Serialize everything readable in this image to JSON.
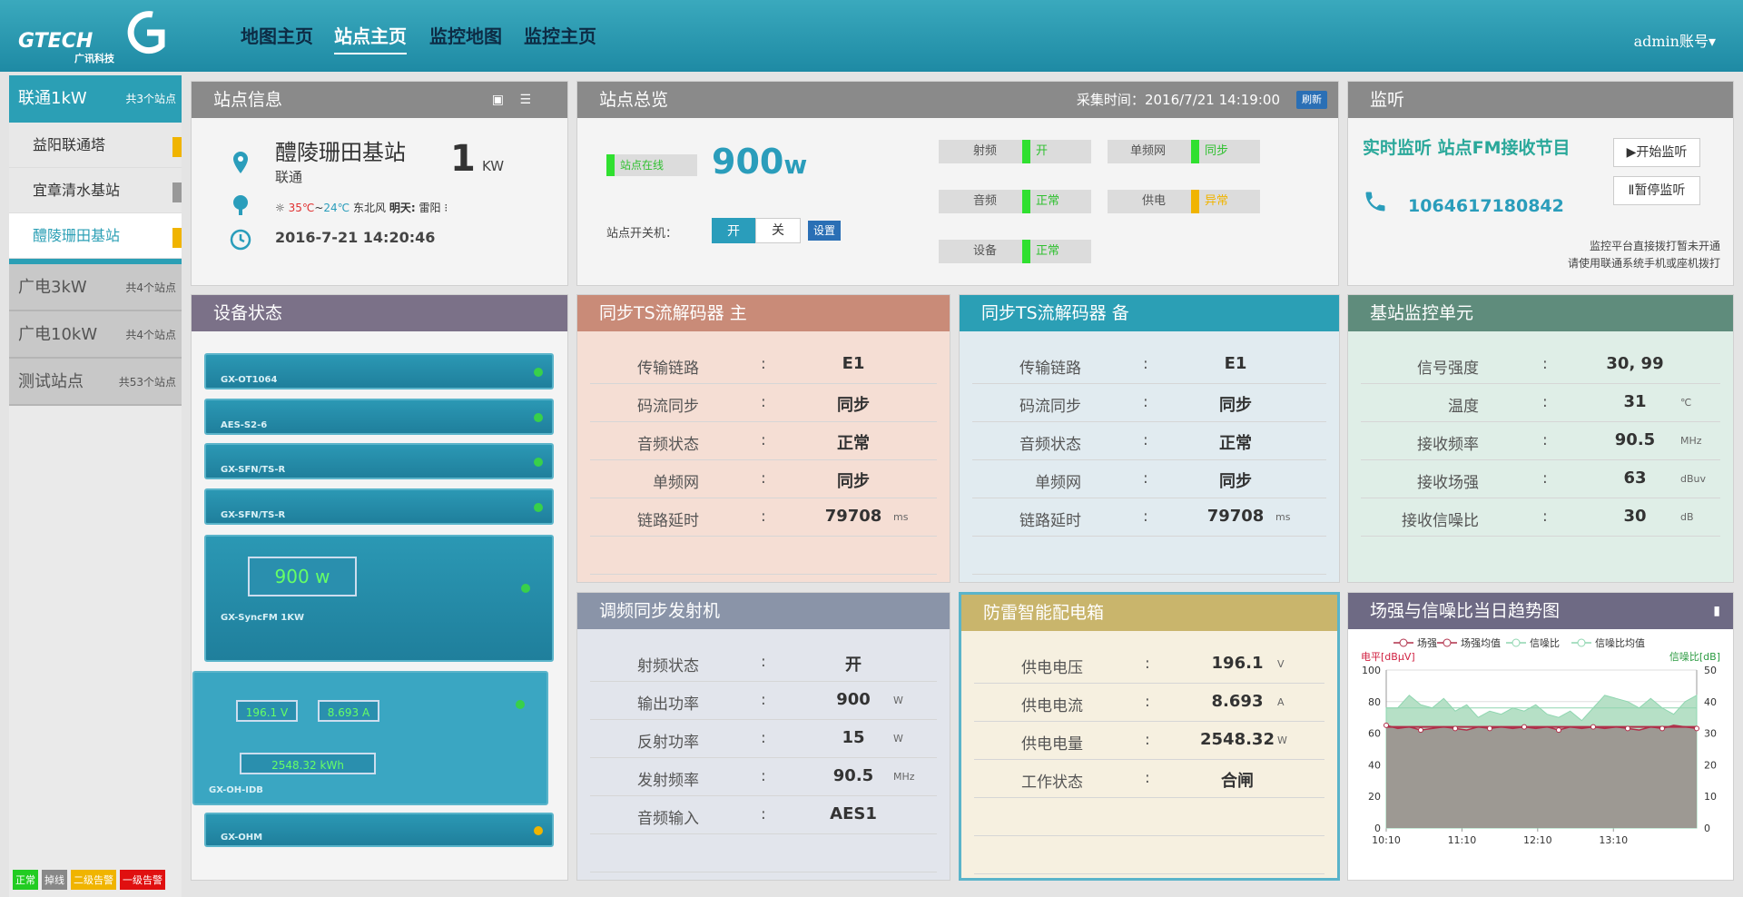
{
  "nav": {
    "logo_text": "GTECH",
    "logo_sub": "广讯科技",
    "items": [
      "地图主页",
      "站点主页",
      "监控地图",
      "监控主页"
    ],
    "account": "admin账号▾"
  },
  "sidebar": {
    "group1": {
      "label": "联通1kW",
      "count": "共3个站点"
    },
    "items": [
      {
        "label": "益阳联通塔",
        "flag": "#f0b400"
      },
      {
        "label": "宜章清水基站",
        "flag": "#999999"
      },
      {
        "label": "醴陵珊田基站",
        "flag": "#f0b400"
      }
    ],
    "groups": [
      {
        "label": "广电3kW",
        "count": "共4个站点"
      },
      {
        "label": "广电10kW",
        "count": "共4个站点"
      },
      {
        "label": "测试站点",
        "count": "共53个站点"
      }
    ],
    "legend": [
      {
        "label": "正常",
        "color": "#22cc22"
      },
      {
        "label": "掉线",
        "color": "#888888"
      },
      {
        "label": "二级告警",
        "color": "#f0b400"
      },
      {
        "label": "一级告警",
        "color": "#e01010"
      }
    ]
  },
  "site_info": {
    "title": "站点信息",
    "name": "醴陵珊田基站",
    "power_num": "1",
    "power_unit": "KW",
    "operator": "联通",
    "weather": {
      "temp_hi": "35℃",
      "sep": "~",
      "temp_lo": "24℃",
      "wind": "东北风",
      "tmr_label": "明天:",
      "tmr": "雷阳"
    },
    "time": "2016-7-21 14:20:46"
  },
  "overview": {
    "title": "站点总览",
    "collect_label": "采集时间：",
    "collect_time": "2016/7/21 14:19:00",
    "refresh": "刷新",
    "online": "站点在线",
    "power": "900",
    "power_unit": "w",
    "switch_label": "站点开关机：",
    "on": "开",
    "off": "关",
    "set": "设置",
    "statuses": [
      {
        "label": "射频",
        "value": "开",
        "color": "#30e030"
      },
      {
        "label": "单频网",
        "value": "同步",
        "color": "#30e030"
      },
      {
        "label": "音频",
        "value": "正常",
        "color": "#30e030"
      },
      {
        "label": "供电",
        "value": "异常",
        "color": "#f0b400"
      },
      {
        "label": "设备",
        "value": "正常",
        "color": "#30e030"
      }
    ]
  },
  "listen": {
    "title": "监听",
    "heading": "实时监听 站点FM接收节目",
    "phone": "1064617180842",
    "start": "▶开始监听",
    "stop": "Ⅱ暂停监听",
    "note1": "监控平台直接拨打暂未开通",
    "note2": "请使用联通系统手机或座机拨打"
  },
  "device_status": {
    "title": "设备状态",
    "devices": [
      "GX-OT1064",
      "AES-S2-6",
      "GX-SFN/TS-R",
      "GX-SFN/TS-R",
      "GX-SyncFM 1KW",
      "GX-OH-IDB",
      "GX-OHM"
    ],
    "power_display": "900 w",
    "volt": "196.1 V",
    "amp": "8.693 A",
    "energy": "2548.32 kWh"
  },
  "ts_main": {
    "title": "同步TS流解码器  主",
    "rows": [
      {
        "k": "传输链路",
        "v": "E1",
        "u": ""
      },
      {
        "k": "码流同步",
        "v": "同步",
        "u": ""
      },
      {
        "k": "音频状态",
        "v": "正常",
        "u": ""
      },
      {
        "k": "单频网",
        "v": "同步",
        "u": ""
      },
      {
        "k": "链路延时",
        "v": "79708",
        "u": "ms"
      }
    ]
  },
  "ts_backup": {
    "title": "同步TS流解码器  备",
    "rows": [
      {
        "k": "传输链路",
        "v": "E1",
        "u": ""
      },
      {
        "k": "码流同步",
        "v": "同步",
        "u": ""
      },
      {
        "k": "音频状态",
        "v": "正常",
        "u": ""
      },
      {
        "k": "单频网",
        "v": "同步",
        "u": ""
      },
      {
        "k": "链路延时",
        "v": "79708",
        "u": "ms"
      }
    ]
  },
  "base_monitor": {
    "title": "基站监控单元",
    "rows": [
      {
        "k": "信号强度",
        "v": "30, 99",
        "u": ""
      },
      {
        "k": "温度",
        "v": "31",
        "u": "℃"
      },
      {
        "k": "接收频率",
        "v": "90.5",
        "u": "MHz"
      },
      {
        "k": "接收场强",
        "v": "63",
        "u": "dBuv"
      },
      {
        "k": "接收信噪比",
        "v": "30",
        "u": "dB"
      }
    ]
  },
  "fm_tx": {
    "title": "调频同步发射机",
    "rows": [
      {
        "k": "射频状态",
        "v": "开",
        "u": ""
      },
      {
        "k": "输出功率",
        "v": "900",
        "u": "W"
      },
      {
        "k": "反射功率",
        "v": "15",
        "u": "W"
      },
      {
        "k": "发射频率",
        "v": "90.5",
        "u": "MHz"
      },
      {
        "k": "音频输入",
        "v": "AES1",
        "u": ""
      }
    ]
  },
  "power_box": {
    "title": "防雷智能配电箱",
    "rows": [
      {
        "k": "供电电压",
        "v": "196.1",
        "u": "V"
      },
      {
        "k": "供电电流",
        "v": "8.693",
        "u": "A"
      },
      {
        "k": "供电电量",
        "v": "2548.32",
        "u": "W"
      },
      {
        "k": "工作状态",
        "v": "合闸",
        "u": ""
      }
    ]
  },
  "chart_data": {
    "type": "line",
    "title": "场强与信噪比当日趋势图",
    "ylabel": "电平[dBμV]",
    "y2label": "信噪比[dB]",
    "ylim": [
      0,
      100
    ],
    "y2lim": [
      0,
      50
    ],
    "x_ticks": [
      "10:10",
      "11:10",
      "12:10",
      "13:10"
    ],
    "y_ticks": [
      0,
      20,
      40,
      60,
      80,
      100
    ],
    "y2_ticks": [
      0,
      10,
      20,
      30,
      40,
      50
    ],
    "series": [
      {
        "name": "场强",
        "color": "#b0304a",
        "axis": "left",
        "values": [
          65,
          63,
          64,
          62,
          63,
          64,
          63,
          62,
          64,
          63,
          64,
          63,
          64,
          63,
          64,
          62,
          64,
          63,
          64,
          63,
          64,
          63,
          62,
          64,
          63,
          65,
          64,
          63
        ]
      },
      {
        "name": "场强均值",
        "color": "#b0304a",
        "axis": "left",
        "values": [
          64,
          64,
          64,
          64,
          64,
          64,
          64,
          64,
          64,
          64,
          64,
          64,
          64,
          64,
          64,
          64,
          64,
          64,
          64,
          64,
          64,
          64,
          64,
          64,
          64,
          64,
          64,
          64
        ]
      },
      {
        "name": "信噪比",
        "color": "#8fd6b0",
        "axis": "right",
        "values": [
          38,
          38,
          42,
          39,
          38,
          41,
          37,
          39,
          35,
          37,
          36,
          38,
          37,
          39,
          36,
          35,
          37,
          34,
          38,
          42,
          41,
          40,
          38,
          41,
          38,
          36,
          40,
          42
        ]
      },
      {
        "name": "信噪比均值",
        "color": "#8fd6b0",
        "axis": "right",
        "values": [
          38,
          38,
          38,
          38,
          38,
          38,
          38,
          38,
          38,
          38,
          38,
          38,
          38,
          38,
          38,
          38,
          38,
          38,
          38,
          38,
          38,
          38,
          38,
          38,
          38,
          38,
          38,
          38
        ]
      }
    ]
  }
}
